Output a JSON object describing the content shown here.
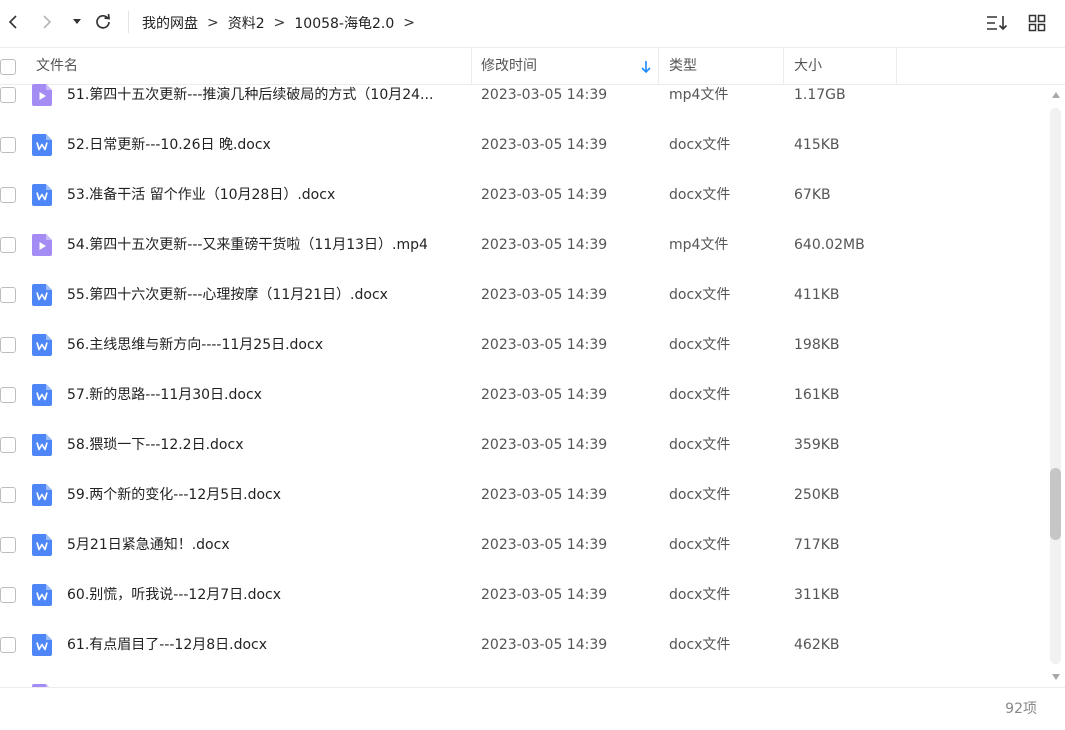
{
  "toolbar": {
    "back_icon": "chevron-left-icon",
    "forward_icon": "chevron-right-icon",
    "history_icon": "caret-down-icon",
    "refresh_icon": "refresh-icon",
    "sort_icon": "sort-list-icon",
    "view_icon": "grid-view-icon"
  },
  "breadcrumb": [
    {
      "label": "我的网盘"
    },
    {
      "label": "资料2"
    },
    {
      "label": "10058-海龟2.0"
    }
  ],
  "breadcrumb_sep": ">",
  "columns": {
    "name": "文件名",
    "modified": "修改时间",
    "type": "类型",
    "size": "大小"
  },
  "sort": {
    "column": "modified",
    "direction": "down",
    "color": "#1a8cff"
  },
  "colors": {
    "word": "#4f86f7",
    "video": "#a58cf5"
  },
  "files": [
    {
      "name": "51.第四十五次更新---推演几种后续破局的方式（10月24...",
      "modified": "2023-03-05 14:39",
      "type": "mp4文件",
      "size": "1.17GB",
      "icon": "video-file-icon"
    },
    {
      "name": "52.日常更新---10.26日 晚.docx",
      "modified": "2023-03-05 14:39",
      "type": "docx文件",
      "size": "415KB",
      "icon": "word-file-icon"
    },
    {
      "name": "53.准备干活 留个作业（10月28日）.docx",
      "modified": "2023-03-05 14:39",
      "type": "docx文件",
      "size": "67KB",
      "icon": "word-file-icon"
    },
    {
      "name": "54.第四十五次更新---又来重磅干货啦（11月13日）.mp4",
      "modified": "2023-03-05 14:39",
      "type": "mp4文件",
      "size": "640.02MB",
      "icon": "video-file-icon"
    },
    {
      "name": "55.第四十六次更新---心理按摩（11月21日）.docx",
      "modified": "2023-03-05 14:39",
      "type": "docx文件",
      "size": "411KB",
      "icon": "word-file-icon"
    },
    {
      "name": "56.主线思维与新方向----11月25日.docx",
      "modified": "2023-03-05 14:39",
      "type": "docx文件",
      "size": "198KB",
      "icon": "word-file-icon"
    },
    {
      "name": "57.新的思路---11月30日.docx",
      "modified": "2023-03-05 14:39",
      "type": "docx文件",
      "size": "161KB",
      "icon": "word-file-icon"
    },
    {
      "name": "58.猥琐一下---12.2日.docx",
      "modified": "2023-03-05 14:39",
      "type": "docx文件",
      "size": "359KB",
      "icon": "word-file-icon"
    },
    {
      "name": "59.两个新的变化---12月5日.docx",
      "modified": "2023-03-05 14:39",
      "type": "docx文件",
      "size": "250KB",
      "icon": "word-file-icon"
    },
    {
      "name": "5月21日紧急通知！.docx",
      "modified": "2023-03-05 14:39",
      "type": "docx文件",
      "size": "717KB",
      "icon": "word-file-icon"
    },
    {
      "name": "60.别慌，听我说---12月7日.docx",
      "modified": "2023-03-05 14:39",
      "type": "docx文件",
      "size": "311KB",
      "icon": "word-file-icon"
    },
    {
      "name": "61.有点眉目了---12月8日.docx",
      "modified": "2023-03-05 14:39",
      "type": "docx文件",
      "size": "462KB",
      "icon": "word-file-icon"
    },
    {
      "name": "",
      "modified": "",
      "type": "",
      "size": "",
      "icon": "video-file-icon"
    }
  ],
  "footer": {
    "count": "92项"
  }
}
